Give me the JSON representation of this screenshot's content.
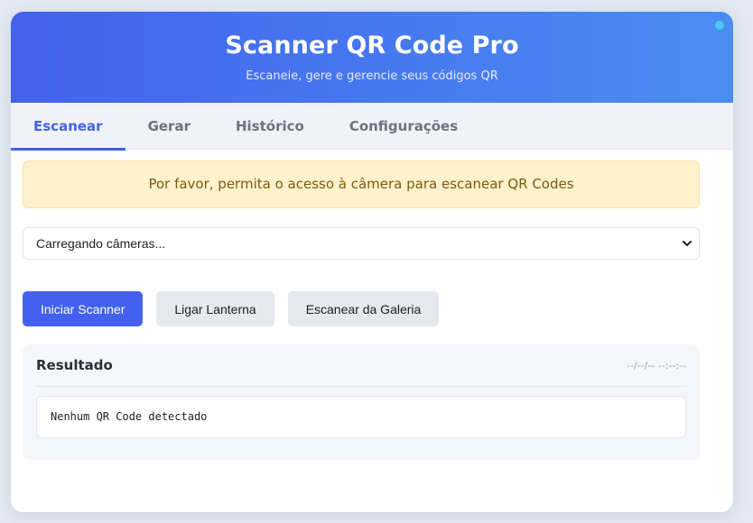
{
  "header": {
    "title": "Scanner QR Code Pro",
    "subtitle": "Escaneie, gere e gerencie seus códigos QR"
  },
  "tabs": [
    {
      "label": "Escanear",
      "active": true
    },
    {
      "label": "Gerar",
      "active": false
    },
    {
      "label": "Histórico",
      "active": false
    },
    {
      "label": "Configurações",
      "active": false
    }
  ],
  "alert": {
    "message": "Por favor, permita o acesso à câmera para escanear QR Codes"
  },
  "camera_select": {
    "value": "Carregando câmeras..."
  },
  "actions": {
    "start_scanner": "Iniciar Scanner",
    "flashlight": "Ligar Lanterna",
    "gallery": "Escanear da Galeria"
  },
  "result": {
    "title": "Resultado",
    "timestamp": "--/--/-- --:--:--",
    "content": "Nenhum QR Code detectado"
  },
  "colors": {
    "accent": "#4361ee",
    "header_gradient_end": "#4a8ef0",
    "status_dot": "#4cc9f0",
    "alert_bg": "#fdf2cc"
  }
}
